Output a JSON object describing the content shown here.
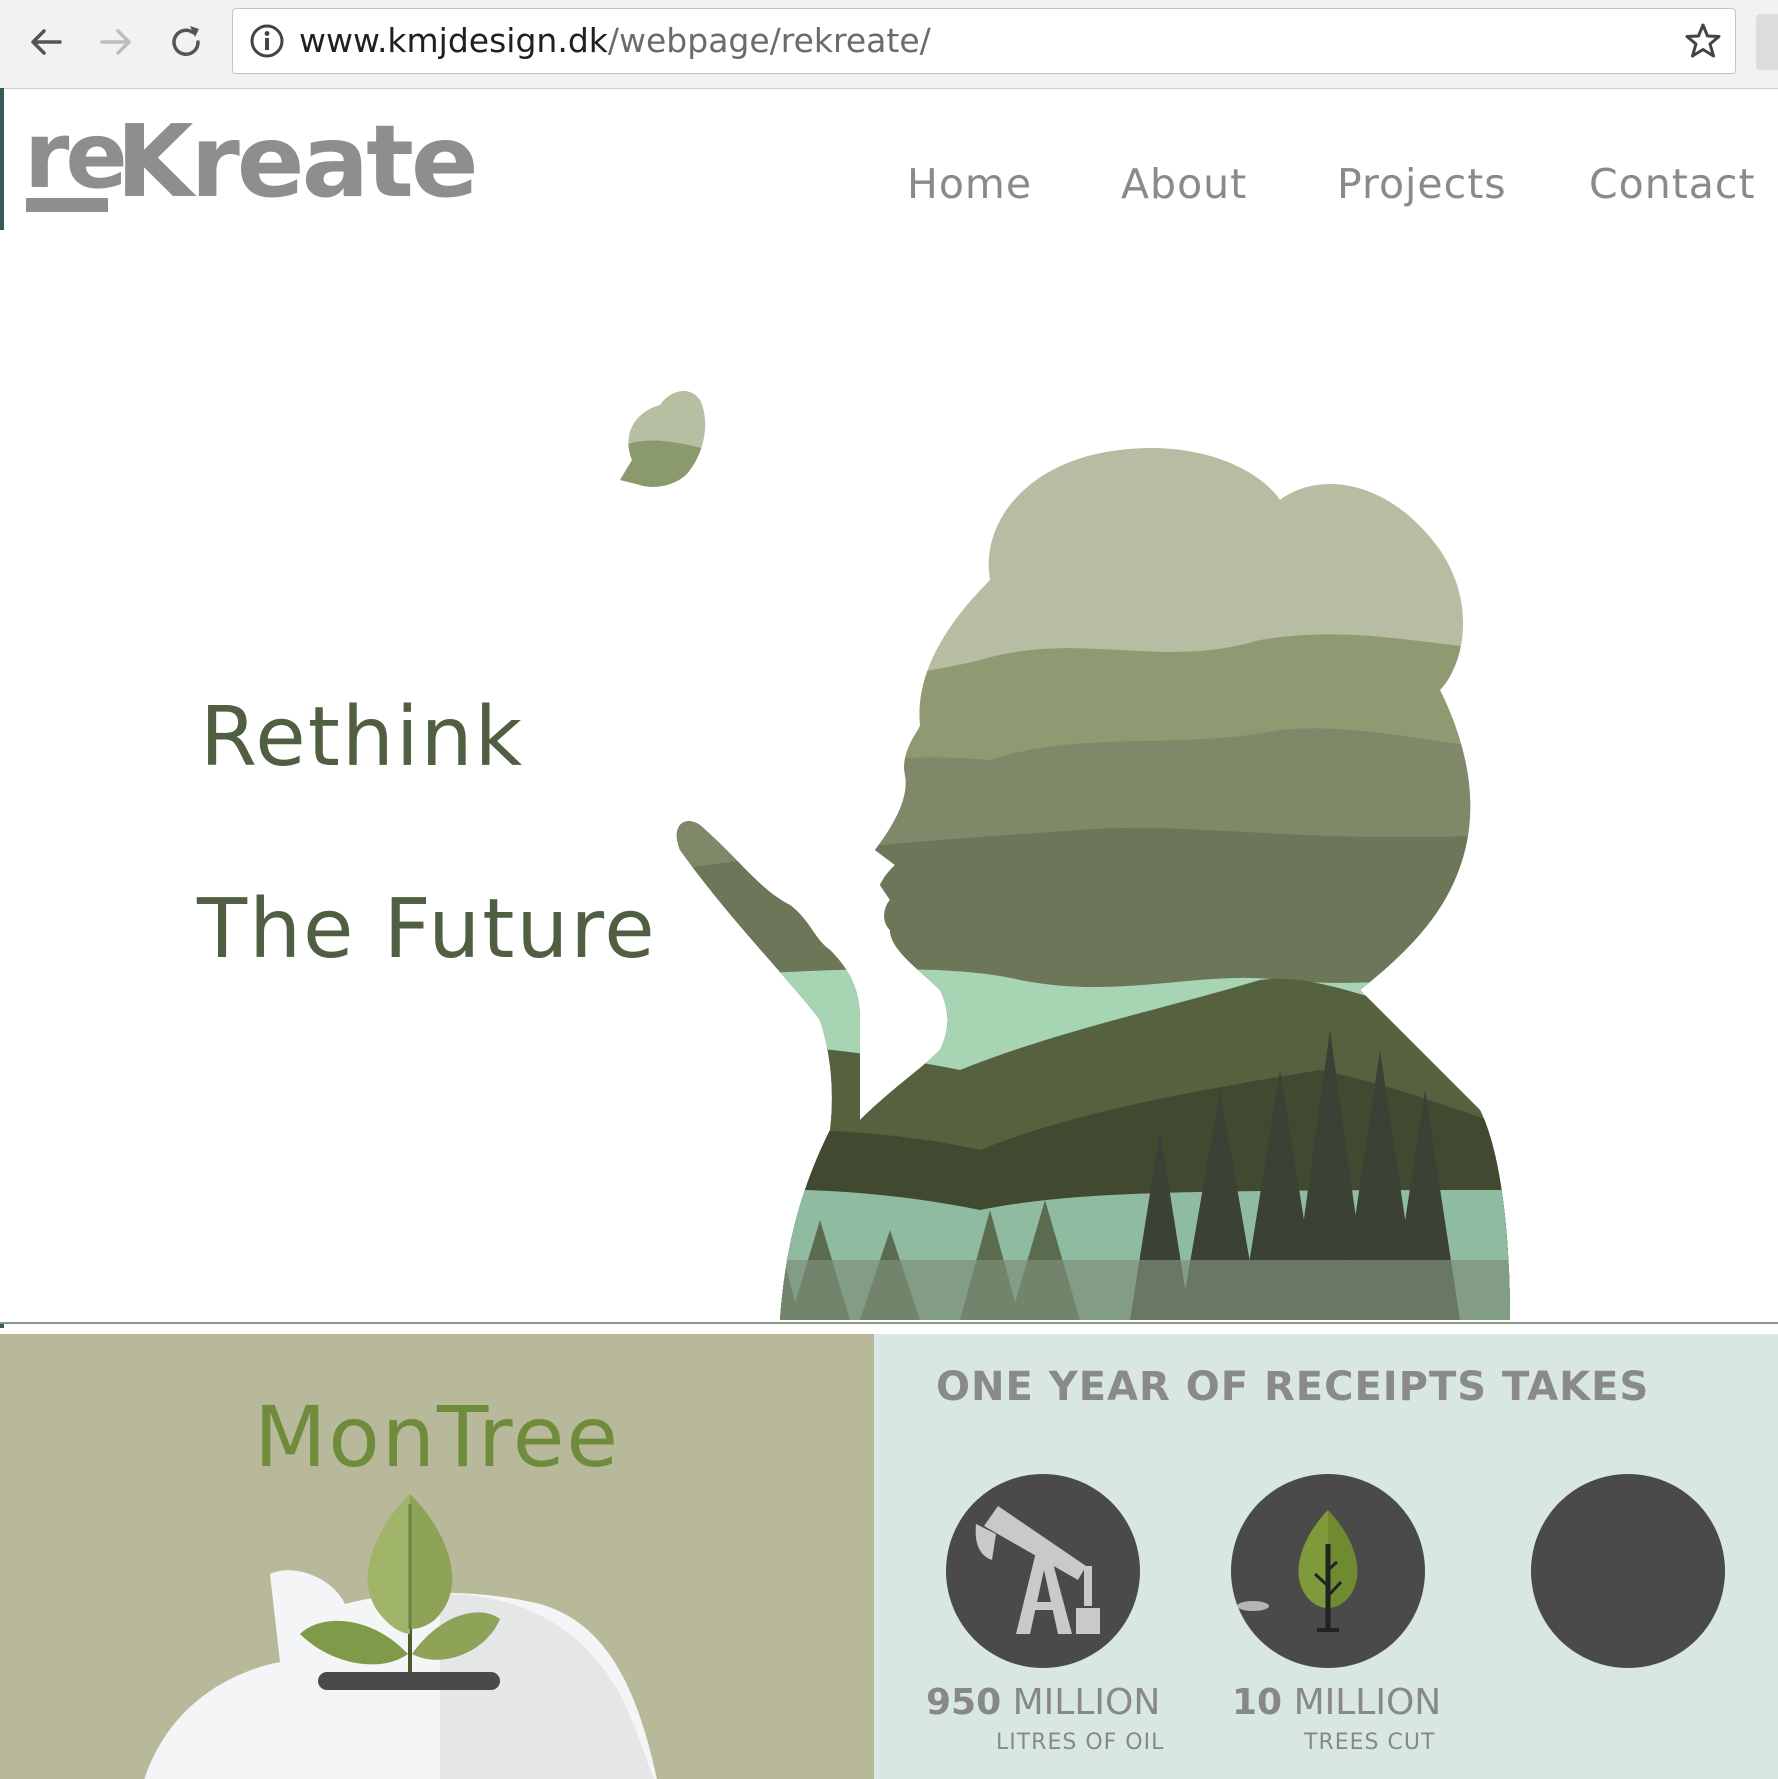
{
  "browser": {
    "url_domain": "www.kmjdesign.dk",
    "url_path": "/webpage/rekreate/"
  },
  "header": {
    "logo_re": "re",
    "logo_kreate": "Kreate",
    "nav": [
      "Home",
      "About",
      "Projects",
      "Contact"
    ]
  },
  "hero": {
    "line1": "Rethink",
    "line2": "The Future"
  },
  "montree": {
    "title": "MonTree"
  },
  "receipts": {
    "heading": "ONE YEAR OF RECEIPTS TAKES",
    "stats": [
      {
        "number": "950",
        "unit": "MILLION",
        "caption": "LITRES OF OIL",
        "icon": "oil-pump-icon"
      },
      {
        "number": "10",
        "unit": "MILLION",
        "caption": "TREES CUT",
        "icon": "tree-icon"
      }
    ]
  },
  "colors": {
    "hero_text": "#505f42",
    "nav_text": "#8a8a8a",
    "montree_panel": "#b8b99a",
    "montree_title": "#6f8c3c",
    "receipts_panel": "#d9e7e4",
    "stat_circle": "#4a4a4a"
  }
}
